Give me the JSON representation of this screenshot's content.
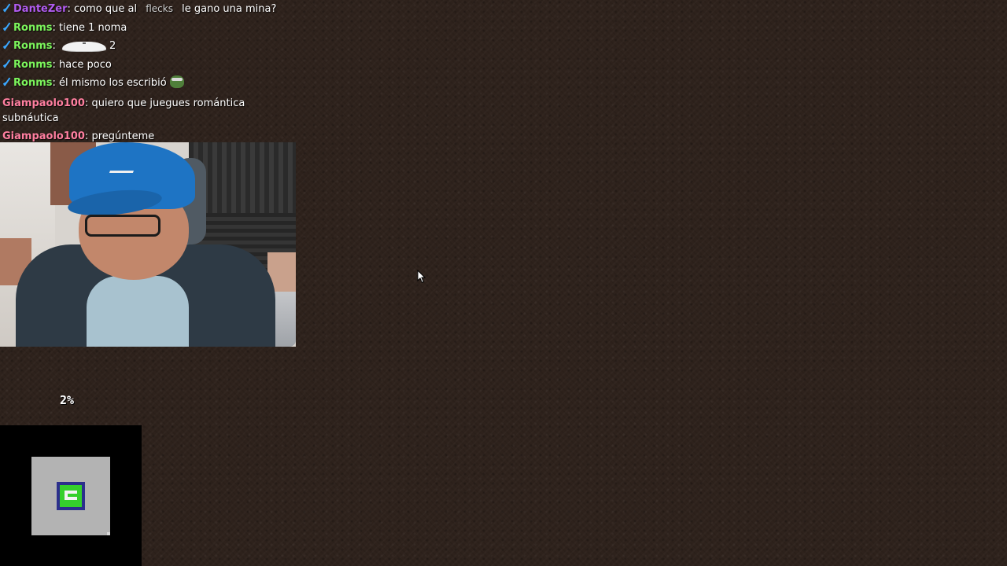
{
  "chat": {
    "messages": [
      {
        "user": "DanteZer",
        "color": "#b15cf0",
        "badge": "sword-badge",
        "parts": [
          "como que al",
          "flecks",
          "le gano una mina?"
        ]
      },
      {
        "user": "Ronms",
        "color": "#7cf55c",
        "badge": "sword-badge",
        "text": "tiene 1 noma"
      },
      {
        "user": "Ronms",
        "color": "#7cf55c",
        "badge": "sword-badge",
        "emote": "dish-emote",
        "text_after": "2"
      },
      {
        "user": "Ronms",
        "color": "#7cf55c",
        "badge": "sword-badge",
        "text": "hace poco"
      },
      {
        "user": "Ronms",
        "color": "#7cf55c",
        "badge": "sword-badge",
        "text": "él mismo los escribió",
        "emote": "pepe-emote"
      },
      {
        "user": "Giampaolo100",
        "color": "#ff7fa0",
        "text": "quiero que juegues romántica subnáutica"
      },
      {
        "user": "Giampaolo100",
        "color": "#ff7fa0",
        "text": "pregúnteme"
      }
    ]
  },
  "overlay": {
    "percent": "2%"
  },
  "colors": {
    "background": "#2e221c",
    "panel": "#000000",
    "tile": "#b3b3b3",
    "icon_border": "#2c2f8c",
    "icon_fill": "#35d02c"
  }
}
